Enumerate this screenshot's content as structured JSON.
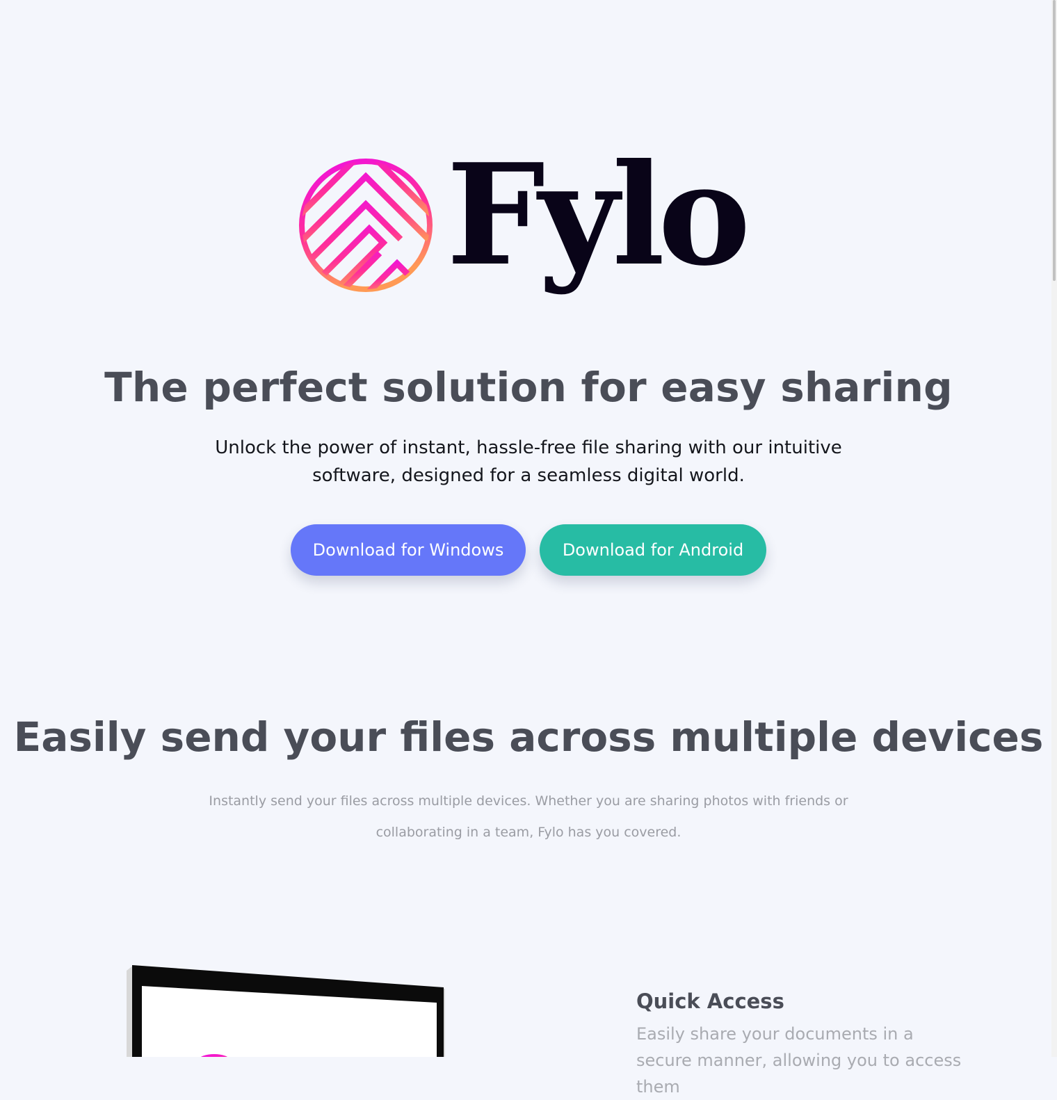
{
  "brand": {
    "name": "Fylo",
    "gradient_start": "#ef10e0",
    "gradient_end": "#ff9a55",
    "wordmark_color": "#090418"
  },
  "hero": {
    "title": "The perfect solution for easy sharing",
    "subtitle": "Unlock the power of instant, hassle-free file sharing with our intuitive software, designed for a seamless digital world.",
    "buttons": {
      "windows_label": "Download for Windows",
      "android_label": "Download for Android"
    },
    "colors": {
      "windows_button": "#6577f9",
      "android_button": "#27bca4"
    }
  },
  "devices_section": {
    "title": "Easily send your files across multiple devices",
    "description": "Instantly send your files across multiple devices. Whether you are sharing photos with friends or collaborating in a team, Fylo has you covered."
  },
  "features": [
    {
      "title": "Quick Access",
      "description": "Easily share your documents in a secure manner, allowing you to access them"
    }
  ]
}
